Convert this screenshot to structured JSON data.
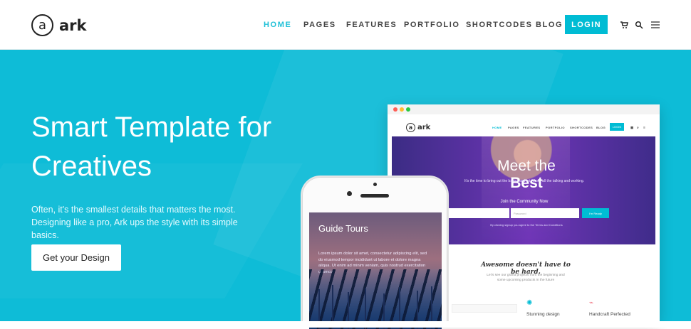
{
  "nav": {
    "logo_letter": "a",
    "logo_text": "ark",
    "items": [
      {
        "label": "HOME",
        "active": true
      },
      {
        "label": "PAGES",
        "active": false
      },
      {
        "label": "FEATURES",
        "active": false
      },
      {
        "label": "PORTFOLIO",
        "active": false
      },
      {
        "label": "SHORTCODES",
        "active": false
      },
      {
        "label": "BLOG",
        "active": false
      }
    ],
    "login_label": "LOGIN",
    "icons": [
      "cart-icon",
      "search-icon",
      "menu-icon"
    ]
  },
  "hero": {
    "headline": "Smart Template for Creatives",
    "description_line1": "Often, it's the smallest details that matters the most.",
    "description_line2": "Designing like a pro, Ark ups the style with its simple basics.",
    "cta_label": "Get your Design",
    "background_color": "#0EBCD7"
  },
  "browser_preview": {
    "logo_letter": "a",
    "logo_text": "ark",
    "menu": [
      "HOME",
      "PAGES",
      "FEATURES",
      "PORTFOLIO",
      "SHORTCODES",
      "BLOG"
    ],
    "login_label": "LOGIN",
    "headline_prefix": "Meet the",
    "headline_emphasis": "Best",
    "subtitle": "It's the time to bring out the basics and let Ark do all the talking and working.",
    "join_label": "Join the Community Now",
    "password_placeholder": "Password",
    "button_label": "I'm Ready",
    "terms": "By clicking signup you agree to the Terms and Conditions",
    "section_title": "Awesome doesn't have to be hard.",
    "section_text_line1": "Let's see our grand projects from the beginning and",
    "section_text_line2": "some upcoming products in the future",
    "features": [
      "Stunning design",
      "Handcraft Perfected"
    ]
  },
  "phone_preview": {
    "title": "Guide Tours",
    "text": "Lorem ipsum dolor sit amet, consectetur adipiscing elit, sed do eiusmod tempor incididunt ut labore et dolore magna aliqua. Ut enim ad minim veniam, quis nostrud exercitation ullamco"
  }
}
